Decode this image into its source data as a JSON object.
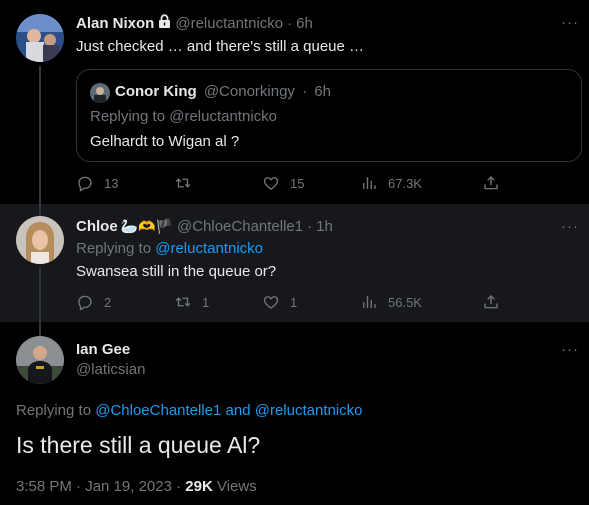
{
  "tweets": [
    {
      "name": "Alan Nixon",
      "handle": "@reluctantnicko",
      "time": "6h",
      "text": "Just checked … and there's still a queue …",
      "quote": {
        "name": "Conor King",
        "handle": "@Conorkingy",
        "time": "6h",
        "replying_prefix": "Replying to",
        "replying_to": "@reluctantnicko",
        "text": "Gelhardt to Wigan al ?"
      },
      "stats": {
        "replies": "13",
        "retweets": "",
        "likes": "15",
        "views": "67.3K"
      }
    },
    {
      "name": "Chloe",
      "name_emoji": "🦢🫶🏴",
      "handle": "@ChloeChantelle1",
      "time": "1h",
      "replying_prefix": "Replying to",
      "replying_to": "@reluctantnicko",
      "text": "Swansea still in the queue or?",
      "stats": {
        "replies": "2",
        "retweets": "1",
        "likes": "1",
        "views": "56.5K"
      }
    },
    {
      "name": "Ian Gee",
      "handle": "@laticsian",
      "replying_prefix": "Replying to",
      "replying_to_1": "@ChloeChantelle1",
      "replying_and": "and",
      "replying_to_2": "@reluctantnicko",
      "text": "Is there still a queue Al?",
      "timestamp": "3:58 PM · Jan 19, 2023 ·",
      "views_count": "29K",
      "views_label": "Views"
    }
  ],
  "more_label": "···",
  "dot": "·",
  "colors": {
    "bg": "#000000",
    "highlight_bg": "#16181c",
    "accent": "#1d9bf0",
    "muted": "#71767b",
    "text": "#e7e9ea"
  }
}
